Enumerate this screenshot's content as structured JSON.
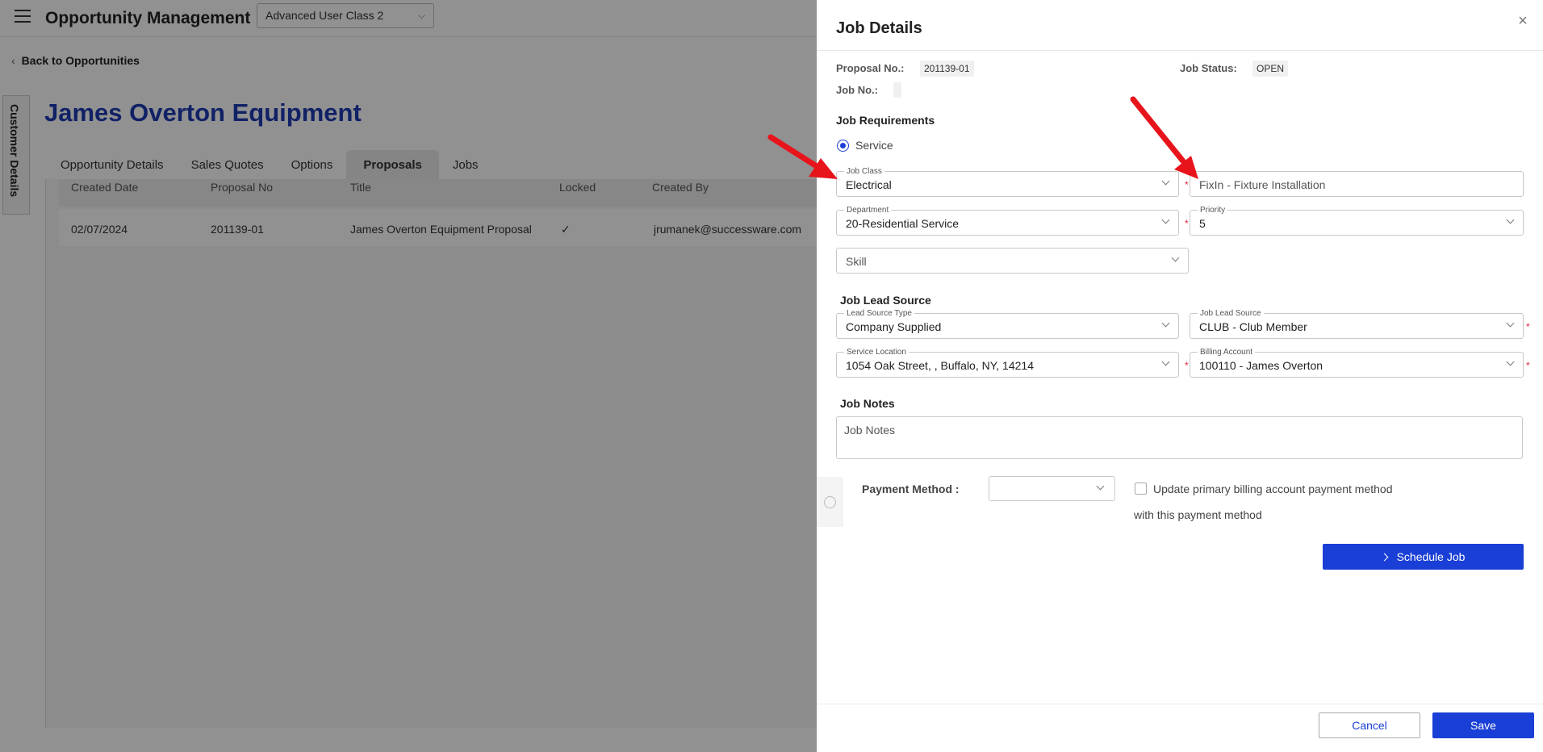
{
  "app": {
    "title": "Opportunity Management",
    "class_select": "Advanced User Class 2",
    "back_link": "Back to Opportunities",
    "side_tab": "Customer Details",
    "customer_name": "James Overton Equipment"
  },
  "tabs": [
    {
      "label": "Opportunity Details"
    },
    {
      "label": "Sales Quotes"
    },
    {
      "label": "Options"
    },
    {
      "label": "Proposals"
    },
    {
      "label": "Jobs"
    }
  ],
  "grid": {
    "headers": [
      "Created Date",
      "Proposal No",
      "Title",
      "Locked",
      "Created By"
    ],
    "rows": [
      {
        "created_date": "02/07/2024",
        "proposal_no": "201139-01",
        "title": "James Overton Equipment Proposal",
        "locked": "✓",
        "created_by": "jrumanek@successware.com"
      }
    ]
  },
  "drawer": {
    "title": "Job Details",
    "close": "×",
    "proposal_label": "Proposal No.:",
    "proposal_value": "201139-01",
    "job_status_label": "Job Status:",
    "job_status_value": "OPEN",
    "job_no_label": "Job No.:",
    "job_no_value": "",
    "requirements_title": "Job Requirements",
    "service_label": "Service",
    "job_class": {
      "label": "Job Class",
      "value": "Electrical"
    },
    "job_type": {
      "value": "FixIn - Fixture Installation"
    },
    "department": {
      "label": "Department",
      "value": "20-Residential Service"
    },
    "priority": {
      "label": "Priority",
      "value": "5"
    },
    "skill": {
      "placeholder": "Skill"
    },
    "lead_title": "Job Lead Source",
    "lead_source_type": {
      "label": "Lead Source Type",
      "value": "Company Supplied"
    },
    "job_lead_source": {
      "label": "Job Lead Source",
      "value": "CLUB - Club Member"
    },
    "service_location": {
      "label": "Service Location",
      "value": "1054 Oak Street, , Buffalo, NY, 14214"
    },
    "billing_account": {
      "label": "Billing Account",
      "value": "100110 - James Overton"
    },
    "notes_title": "Job Notes",
    "notes_placeholder": "Job Notes",
    "payment_label": "Payment Method :",
    "payment_value": "",
    "update_text_1": "Update primary billing account payment method",
    "update_text_2": "with this payment method",
    "schedule_label": "Schedule Job",
    "cancel_label": "Cancel",
    "save_label": "Save",
    "required_mark": "*"
  },
  "colors": {
    "primary": "#1a3fd6",
    "title_blue": "#1e3bb3",
    "required": "#e0253f",
    "annotation_arrow": "#e8141c"
  }
}
